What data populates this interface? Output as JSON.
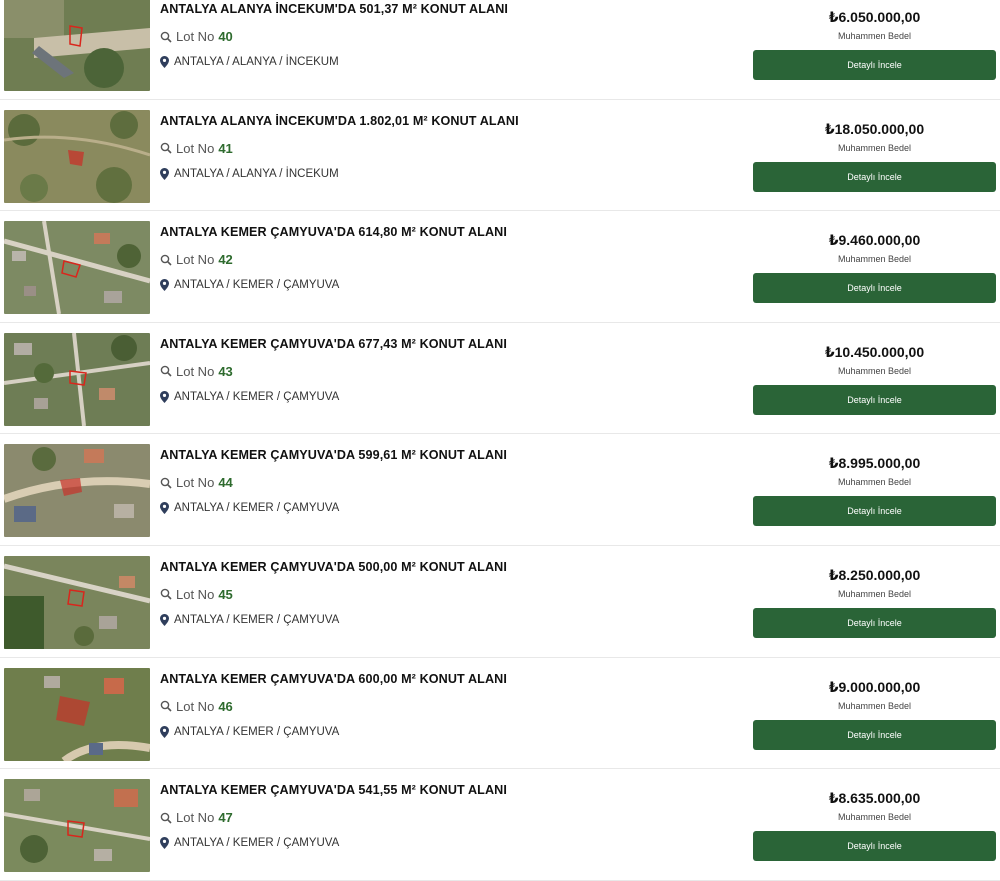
{
  "colors": {
    "accent": "#2a6437",
    "lot_number": "#2e6b2e"
  },
  "icons": {
    "lot": "search-icon",
    "location": "map-pin-icon"
  },
  "listings": [
    {
      "title": "ANTALYA ALANYA İNCEKUM'DA 501,37 M² KONUT ALANI",
      "lot_label": "Lot No",
      "lot_number": "40",
      "location": "ANTALYA / ALANYA / İNCEKUM",
      "price": "₺6.050.000,00",
      "price_caption": "Muhammen Bedel",
      "button_label": "Detaylı İncele"
    },
    {
      "title": "ANTALYA ALANYA İNCEKUM'DA 1.802,01 M² KONUT ALANI",
      "lot_label": "Lot No",
      "lot_number": "41",
      "location": "ANTALYA / ALANYA / İNCEKUM",
      "price": "₺18.050.000,00",
      "price_caption": "Muhammen Bedel",
      "button_label": "Detaylı İncele"
    },
    {
      "title": "ANTALYA KEMER ÇAMYUVA'DA 614,80 M² KONUT ALANI",
      "lot_label": "Lot No",
      "lot_number": "42",
      "location": "ANTALYA / KEMER / ÇAMYUVA",
      "price": "₺9.460.000,00",
      "price_caption": "Muhammen Bedel",
      "button_label": "Detaylı İncele"
    },
    {
      "title": "ANTALYA KEMER ÇAMYUVA'DA 677,43 M² KONUT ALANI",
      "lot_label": "Lot No",
      "lot_number": "43",
      "location": "ANTALYA / KEMER / ÇAMYUVA",
      "price": "₺10.450.000,00",
      "price_caption": "Muhammen Bedel",
      "button_label": "Detaylı İncele"
    },
    {
      "title": "ANTALYA KEMER ÇAMYUVA'DA 599,61 M² KONUT ALANI",
      "lot_label": "Lot No",
      "lot_number": "44",
      "location": "ANTALYA / KEMER / ÇAMYUVA",
      "price": "₺8.995.000,00",
      "price_caption": "Muhammen Bedel",
      "button_label": "Detaylı İncele"
    },
    {
      "title": "ANTALYA KEMER ÇAMYUVA'DA 500,00 M² KONUT ALANI",
      "lot_label": "Lot No",
      "lot_number": "45",
      "location": "ANTALYA / KEMER / ÇAMYUVA",
      "price": "₺8.250.000,00",
      "price_caption": "Muhammen Bedel",
      "button_label": "Detaylı İncele"
    },
    {
      "title": "ANTALYA KEMER ÇAMYUVA'DA 600,00 M² KONUT ALANI",
      "lot_label": "Lot No",
      "lot_number": "46",
      "location": "ANTALYA / KEMER / ÇAMYUVA",
      "price": "₺9.000.000,00",
      "price_caption": "Muhammen Bedel",
      "button_label": "Detaylı İncele"
    },
    {
      "title": "ANTALYA KEMER ÇAMYUVA'DA 541,55 M² KONUT ALANI",
      "lot_label": "Lot No",
      "lot_number": "47",
      "location": "ANTALYA / KEMER / ÇAMYUVA",
      "price": "₺8.635.000,00",
      "price_caption": "Muhammen Bedel",
      "button_label": "Detaylı İncele"
    }
  ]
}
